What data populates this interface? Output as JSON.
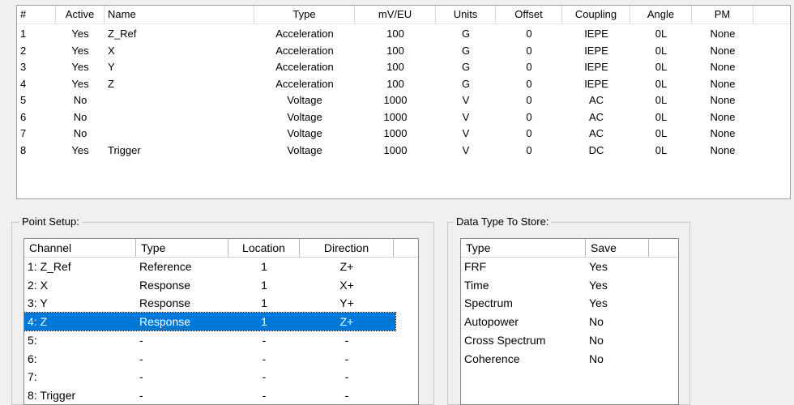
{
  "channels": {
    "columns": [
      "#",
      "Active",
      "Name",
      "Type",
      "mV/EU",
      "Units",
      "Offset",
      "Coupling",
      "Angle",
      "PM"
    ],
    "rows": [
      [
        "1",
        "Yes",
        "Z_Ref",
        "Acceleration",
        "100",
        "G",
        "0",
        "IEPE",
        "0L",
        "None"
      ],
      [
        "2",
        "Yes",
        "X",
        "Acceleration",
        "100",
        "G",
        "0",
        "IEPE",
        "0L",
        "None"
      ],
      [
        "3",
        "Yes",
        "Y",
        "Acceleration",
        "100",
        "G",
        "0",
        "IEPE",
        "0L",
        "None"
      ],
      [
        "4",
        "Yes",
        "Z",
        "Acceleration",
        "100",
        "G",
        "0",
        "IEPE",
        "0L",
        "None"
      ],
      [
        "5",
        "No",
        "",
        "Voltage",
        "1000",
        "V",
        "0",
        "AC",
        "0L",
        "None"
      ],
      [
        "6",
        "No",
        "",
        "Voltage",
        "1000",
        "V",
        "0",
        "AC",
        "0L",
        "None"
      ],
      [
        "7",
        "No",
        "",
        "Voltage",
        "1000",
        "V",
        "0",
        "AC",
        "0L",
        "None"
      ],
      [
        "8",
        "Yes",
        "Trigger",
        "Voltage",
        "1000",
        "V",
        "0",
        "DC",
        "0L",
        "None"
      ]
    ]
  },
  "point_setup": {
    "label": "Point Setup:",
    "columns": [
      "Channel",
      "Type",
      "Location",
      "Direction"
    ],
    "selected_index": 3,
    "rows": [
      [
        "1: Z_Ref",
        "Reference",
        "1",
        "Z+"
      ],
      [
        "2: X",
        "Response",
        "1",
        "X+"
      ],
      [
        "3: Y",
        "Response",
        "1",
        "Y+"
      ],
      [
        "4: Z",
        "Response",
        "1",
        "Z+"
      ],
      [
        "5:",
        "-",
        "-",
        "-"
      ],
      [
        "6:",
        "-",
        "-",
        "-"
      ],
      [
        "7:",
        "-",
        "-",
        "-"
      ],
      [
        "8: Trigger",
        "-",
        "-",
        "-"
      ]
    ]
  },
  "data_type": {
    "label": "Data Type To Store:",
    "columns": [
      "Type",
      "Save"
    ],
    "rows": [
      [
        "FRF",
        "Yes"
      ],
      [
        "Time",
        "Yes"
      ],
      [
        "Spectrum",
        "Yes"
      ],
      [
        "Autopower",
        "No"
      ],
      [
        "Cross Spectrum",
        "No"
      ],
      [
        "Coherence",
        "No"
      ]
    ]
  },
  "colors": {
    "selection": "#0078d7",
    "window_bg": "#f0f0f0"
  }
}
